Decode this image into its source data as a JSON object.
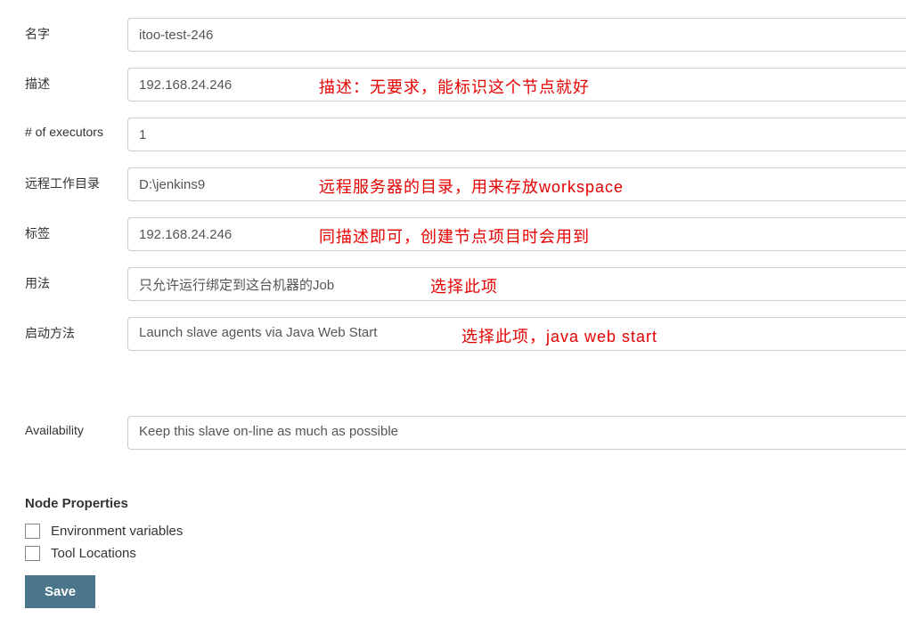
{
  "form": {
    "name": {
      "label": "名字",
      "value": "itoo-test-246"
    },
    "description": {
      "label": "描述",
      "value": "192.168.24.246",
      "annotation": "描述：无要求，能标识这个节点就好"
    },
    "executors": {
      "label": "# of executors",
      "value": "1"
    },
    "remote_dir": {
      "label": "远程工作目录",
      "value": "D:\\jenkins9",
      "annotation": "远程服务器的目录，用来存放workspace"
    },
    "labels": {
      "label": "标签",
      "value": "192.168.24.246",
      "annotation": "同描述即可，创建节点项目时会用到"
    },
    "usage": {
      "label": "用法",
      "value": "只允许运行绑定到这台机器的Job",
      "annotation": "选择此项"
    },
    "launch_method": {
      "label": "启动方法",
      "value": "Launch slave agents via Java Web Start",
      "annotation": "选择此项，java web start"
    },
    "availability": {
      "label": "Availability",
      "value": "Keep this slave on-line as much as possible"
    }
  },
  "node_properties": {
    "header": "Node Properties",
    "env_vars": "Environment variables",
    "tool_locations": "Tool Locations"
  },
  "buttons": {
    "save": "Save"
  }
}
